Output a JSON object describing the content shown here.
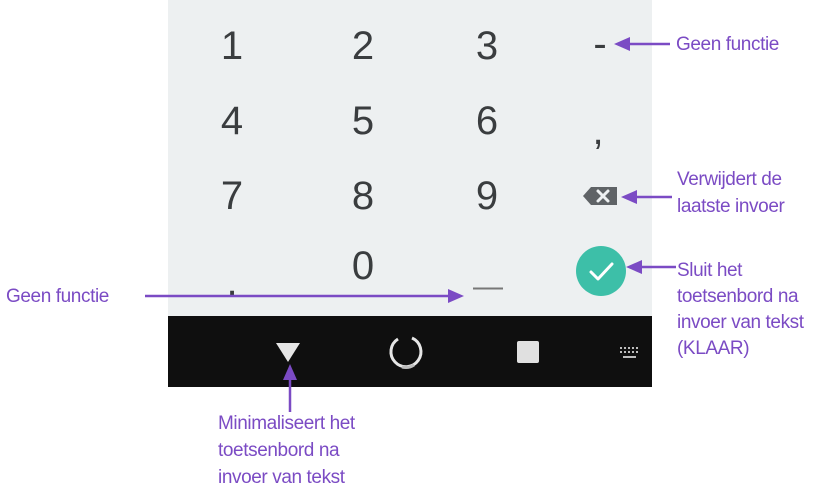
{
  "keyboard": {
    "keys": {
      "k1": "1",
      "k2": "2",
      "k3": "3",
      "dash": "-",
      "k4": "4",
      "k5": "5",
      "k6": "6",
      "comma": ",",
      "k7": "7",
      "k8": "8",
      "k9": "9",
      "dot": ".",
      "k0": "0",
      "space": "—"
    }
  },
  "icons": {
    "backspace": "backspace-icon",
    "done": "check-icon",
    "back": "triangle-down-icon",
    "home": "circle-icon",
    "recents": "square-icon",
    "switch_keyboard": "keyboard-icon"
  },
  "colors": {
    "annotation": "#7b4bc4",
    "done_button": "#3dbfa8",
    "keyboard_bg": "#edf0f1",
    "navbar_bg": "#0f0f0f"
  },
  "annotations": {
    "dash_label": "Geen functie",
    "backspace_label_1": "Verwijdert de",
    "backspace_label_2": "laatste invoer",
    "done_label_1": "Sluit het",
    "done_label_2": "toetsenbord na",
    "done_label_3": "invoer van tekst",
    "done_label_4": "(KLAAR)",
    "space_label": "Geen functie",
    "back_label_1": "Minimaliseert het",
    "back_label_2": "toetsenbord na",
    "back_label_3": "invoer van tekst"
  }
}
